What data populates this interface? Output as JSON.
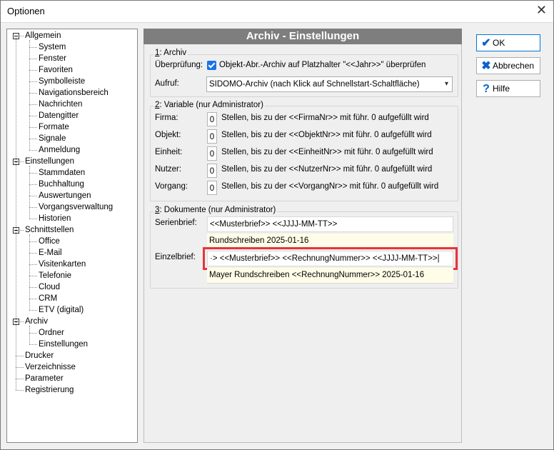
{
  "window": {
    "title": "Optionen",
    "close_glyph": "✕"
  },
  "tree": {
    "nodes": [
      {
        "label": "Allgemein",
        "level": 0,
        "expanded": true
      },
      {
        "label": "System",
        "level": 1
      },
      {
        "label": "Fenster",
        "level": 1
      },
      {
        "label": "Favoriten",
        "level": 1
      },
      {
        "label": "Symbolleiste",
        "level": 1
      },
      {
        "label": "Navigationsbereich",
        "level": 1
      },
      {
        "label": "Nachrichten",
        "level": 1
      },
      {
        "label": "Datengitter",
        "level": 1
      },
      {
        "label": "Formate",
        "level": 1
      },
      {
        "label": "Signale",
        "level": 1
      },
      {
        "label": "Anmeldung",
        "level": 1
      },
      {
        "label": "Einstellungen",
        "level": 0,
        "expanded": true
      },
      {
        "label": "Stammdaten",
        "level": 1
      },
      {
        "label": "Buchhaltung",
        "level": 1
      },
      {
        "label": "Auswertungen",
        "level": 1
      },
      {
        "label": "Vorgangsverwaltung",
        "level": 1
      },
      {
        "label": "Historien",
        "level": 1
      },
      {
        "label": "Schnittstellen",
        "level": 0,
        "expanded": true
      },
      {
        "label": "Office",
        "level": 1
      },
      {
        "label": "E-Mail",
        "level": 1
      },
      {
        "label": "Visitenkarten",
        "level": 1
      },
      {
        "label": "Telefonie",
        "level": 1
      },
      {
        "label": "Cloud",
        "level": 1
      },
      {
        "label": "CRM",
        "level": 1
      },
      {
        "label": "ETV (digital)",
        "level": 1
      },
      {
        "label": "Archiv",
        "level": 0,
        "expanded": true
      },
      {
        "label": "Ordner",
        "level": 1
      },
      {
        "label": "Einstellungen",
        "level": 1
      },
      {
        "label": "Drucker",
        "level": 0
      },
      {
        "label": "Verzeichnisse",
        "level": 0
      },
      {
        "label": "Parameter",
        "level": 0
      },
      {
        "label": "Registrierung",
        "level": 0
      }
    ]
  },
  "main": {
    "title": "Archiv - Einstellungen",
    "archiv": {
      "group_label_num": "1",
      "group_label_rest": ": Archiv",
      "check_label": "Überprüfung:",
      "check_text": "Objekt-Abr.-Archiv auf Platzhalter \"<<Jahr>>\" überprüfen",
      "checked": true,
      "call_label": "Aufruf:",
      "call_value": "SIDOMO-Archiv (nach Klick auf Schnellstart-Schaltfläche)"
    },
    "variable": {
      "group_label_num": "2",
      "group_label_rest": ": Variable  (nur Administrator)",
      "rows": [
        {
          "label": "Firma:",
          "value": "0",
          "text": "Stellen, bis zu der <<FirmaNr>> mit führ. 0 aufgefüllt wird"
        },
        {
          "label": "Objekt:",
          "value": "0",
          "text": "Stellen, bis zu der <<ObjektNr>> mit führ. 0 aufgefüllt wird"
        },
        {
          "label": "Einheit:",
          "value": "0",
          "text": "Stellen, bis zu der <<EinheitNr>> mit führ. 0 aufgefüllt wird"
        },
        {
          "label": "Nutzer:",
          "value": "0",
          "text": "Stellen, bis zu der <<NutzerNr>> mit führ. 0 aufgefüllt wird"
        },
        {
          "label": "Vorgang:",
          "value": "0",
          "text": "Stellen, bis zu der <<VorgangNr>> mit führ. 0 aufgefüllt wird"
        }
      ]
    },
    "dokumente": {
      "group_label_num": "3",
      "group_label_rest": ": Dokumente  (nur Administrator)",
      "serien_label": "Serienbrief:",
      "serien_value": "<<Musterbrief>> <<JJJJ-MM-TT>>",
      "serien_preview": "Rundschreiben 2025-01-16",
      "einzel_label": "Einzelbrief:",
      "einzel_value": "·> <<Musterbrief>> <<RechnungNummer>> <<JJJJ-MM-TT>>|",
      "einzel_preview": "Mayer Rundschreiben <<RechnungNummer>> 2025-01-16"
    }
  },
  "buttons": {
    "ok": {
      "label": "OK",
      "icon": "checkmark-icon",
      "color": "#0a64c8"
    },
    "cancel": {
      "label": "Abbrechen",
      "icon": "x-icon",
      "color": "#0a64c8"
    },
    "help": {
      "label": "Hilfe",
      "icon": "question-icon",
      "color": "#0a64c8"
    }
  },
  "colors": {
    "header_bg": "#7e7e7e",
    "highlight": "#e8333a",
    "preview_bg": "#fffde8",
    "check_blue": "#1a73e8"
  }
}
